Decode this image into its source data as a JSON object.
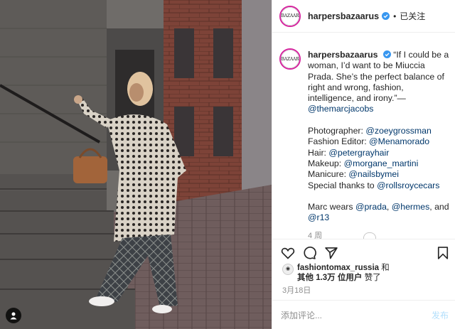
{
  "colors": {
    "link": "#00376b",
    "verified": "#3897f0",
    "muted": "#8e8e8e",
    "post_disabled": "#b2dffc"
  },
  "icons": {
    "photo_tag": "person-icon",
    "verified": "verified-badge-icon",
    "like": "heart-icon",
    "comment": "comment-icon",
    "share": "paper-plane-icon",
    "save": "bookmark-icon"
  },
  "header": {
    "avatar_text": "BAZAAR",
    "username": "harpersbazaarus",
    "separator": "•",
    "follow_status": "已关注"
  },
  "caption": {
    "avatar_text": "BAZAAR",
    "username": "harpersbazaarus",
    "quote": "“If I could be a woman, I’d want to be Miuccia Prada. She’s the perfect balance of right and wrong, fashion, intelligence, and irony.”—",
    "quote_author": "@themarcjacobs",
    "credits": [
      {
        "label": "Photographer: ",
        "handle": "@zoeygrossman"
      },
      {
        "label": "Fashion Editor: ",
        "handle": "@Menamorado"
      },
      {
        "label": "Hair: ",
        "handle": "@petergrayhair"
      },
      {
        "label": "Makeup: ",
        "handle": "@morgane_martini"
      },
      {
        "label": "Manicure: ",
        "handle": "@nailsbymei"
      },
      {
        "label": "Special thanks to ",
        "handle": "@rollsroycecars"
      }
    ],
    "wears_prefix": "Marc wears ",
    "wears_1": "@prada",
    "comma": ", ",
    "wears_2": "@hermes",
    "and": ", and",
    "wears_3": "@r13",
    "time_ago": "4 周"
  },
  "likes": {
    "user": "fashiontomax_russia",
    "and": " 和",
    "others": "其他 1.3万 位用户",
    "liked": " 赞了"
  },
  "date": "3月18日",
  "comment": {
    "placeholder": "添加评论...",
    "post_label": "发布"
  }
}
